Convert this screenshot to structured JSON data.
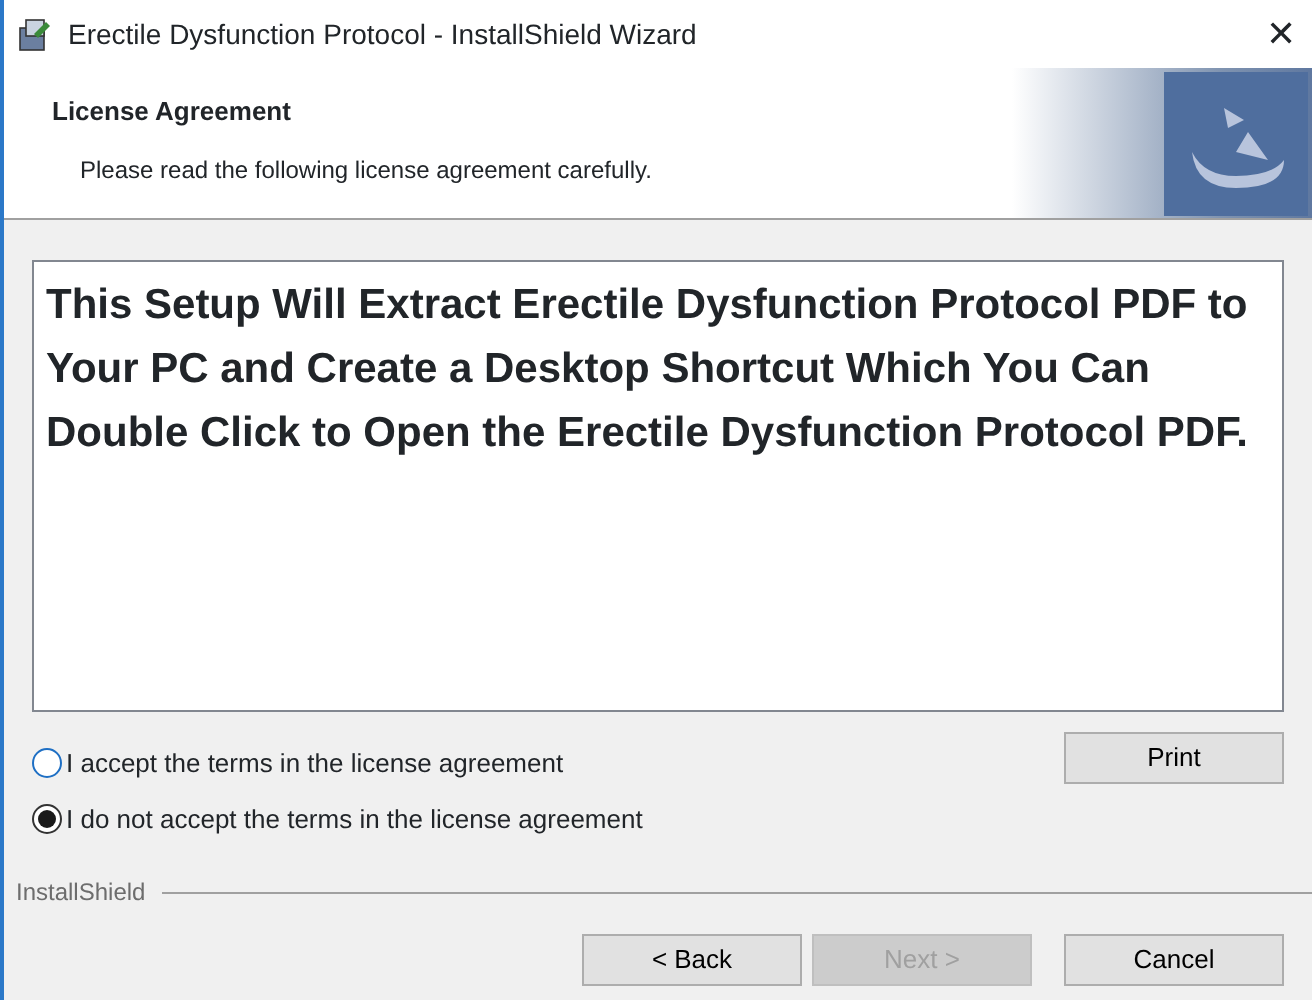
{
  "window": {
    "title": "Erectile Dysfunction Protocol - InstallShield Wizard",
    "close": "✕"
  },
  "header": {
    "title": "License Agreement",
    "subtitle": "Please read the following license agreement carefully."
  },
  "license_text": "This Setup Will Extract Erectile Dysfunction Protocol PDF to Your PC and Create a Desktop Shortcut Which You Can Double Click to Open the Erectile Dysfunction Protocol PDF.",
  "options": [
    {
      "label": "I accept the terms in the license agreement",
      "selected": false
    },
    {
      "label": "I do not accept the terms in the license agreement",
      "selected": true
    }
  ],
  "print_button": "Print",
  "brand": "InstallShield",
  "buttons": [
    {
      "label": "< Back",
      "disabled": false
    },
    {
      "label": "Next >",
      "disabled": true
    },
    {
      "label": "Cancel",
      "disabled": false
    }
  ]
}
